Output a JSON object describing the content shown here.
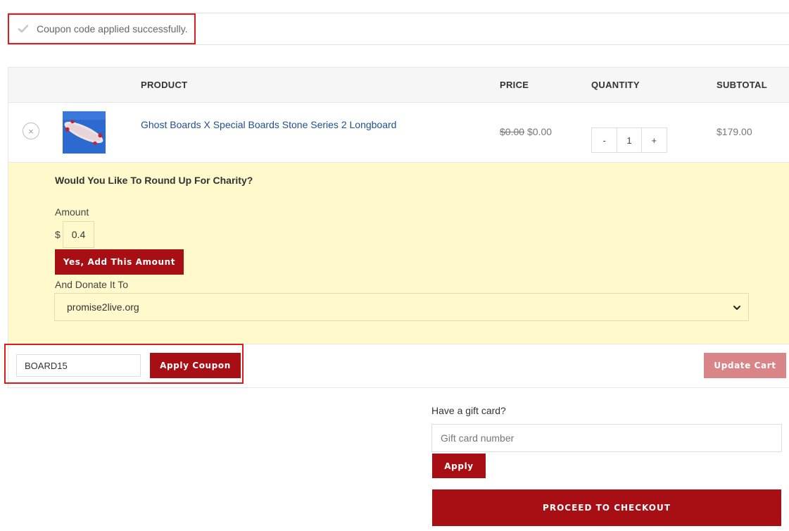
{
  "notice": {
    "message": "Coupon code applied successfully.",
    "icon": "check-icon"
  },
  "cart": {
    "columns": {
      "product": "PRODUCT",
      "price": "PRICE",
      "quantity": "QUANTITY",
      "subtotal": "SUBTOTAL"
    },
    "items": [
      {
        "name": "Ghost Boards X Special Boards Stone Series 2 Longboard",
        "price_original": "$0.00",
        "price_current": "$0.00",
        "quantity": "1",
        "subtotal": "$179.00",
        "remove_symbol": "×",
        "minus": "-",
        "plus": "+"
      }
    ]
  },
  "charity": {
    "title": "Would You Like To Round Up For Charity?",
    "amount_label": "Amount",
    "currency": "$",
    "amount_value": "0.4",
    "add_button": "Yes, Add This Amount",
    "donate_label": "And Donate It To",
    "selected_org": "promise2live.org"
  },
  "coupon": {
    "code": "BOARD15",
    "apply_button": "Apply Coupon",
    "update_button": "Update Cart"
  },
  "gift_card": {
    "label": "Have a gift card?",
    "placeholder": "Gift card number",
    "apply_button": "Apply"
  },
  "checkout": {
    "button": "PROCEED TO CHECKOUT"
  },
  "colors": {
    "brand_red": "#a70f14",
    "highlight_red": "#e11b1b",
    "charity_bg": "#fff9cc",
    "link_blue": "#1f4f8f",
    "disabled_red": "#d98588"
  }
}
